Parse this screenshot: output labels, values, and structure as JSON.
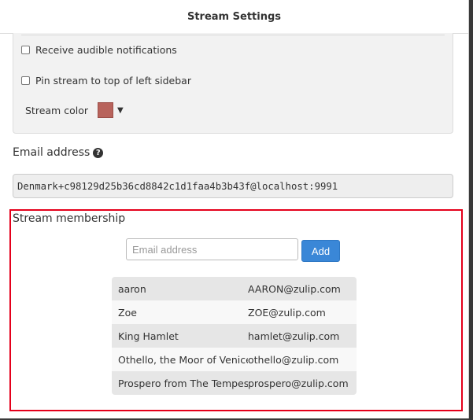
{
  "modal": {
    "title": "Stream Settings"
  },
  "settings": {
    "audible_label": "Receive audible notifications",
    "pin_label": "Pin stream to top of left sidebar",
    "color_label": "Stream color",
    "color_value": "#b8635c",
    "caret": "▼"
  },
  "email": {
    "label": "Email address",
    "help_icon": "?",
    "value": "Denmark+c98129d25b36cd8842c1d1faa4b3b43f@localhost:9991"
  },
  "membership": {
    "title": "Stream membership",
    "input_placeholder": "Email address",
    "add_label": "Add",
    "members": [
      {
        "name": "aaron",
        "email": "AARON@zulip.com"
      },
      {
        "name": "Zoe",
        "email": "ZOE@zulip.com"
      },
      {
        "name": "King Hamlet",
        "email": "hamlet@zulip.com"
      },
      {
        "name": "Othello, the Moor of Venice",
        "email": "othello@zulip.com"
      },
      {
        "name": "Prospero from The Tempest",
        "email": "prospero@zulip.com"
      }
    ]
  },
  "colors": {
    "highlight_border": "#e4001b",
    "button": "#3a87d7"
  }
}
